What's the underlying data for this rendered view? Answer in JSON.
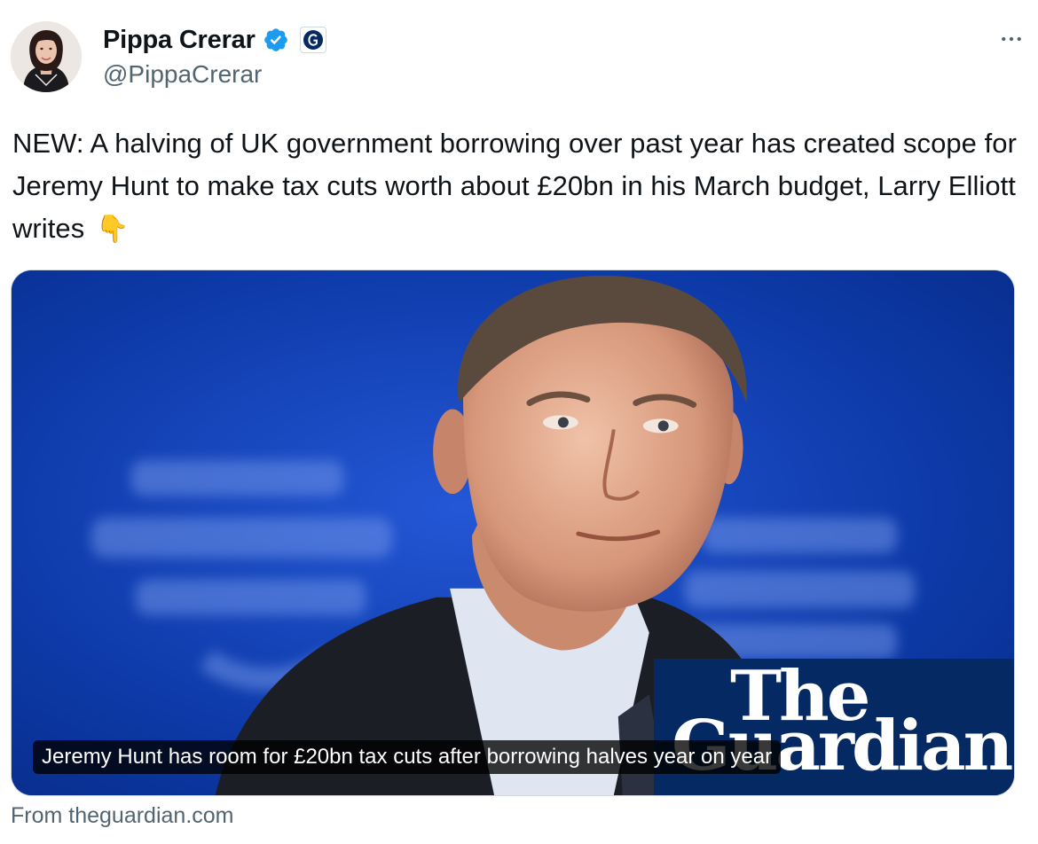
{
  "author": {
    "display_name": "Pippa Crerar",
    "handle": "@PippaCrerar",
    "verified_icon": "verified-badge-icon",
    "affiliate_icon": "guardian-g-icon",
    "avatar_icon": "avatar"
  },
  "more_icon": "more-dots-icon",
  "tweet": {
    "text": "NEW: A halving of UK government borrowing over past year has created scope for Jeremy Hunt to make tax cuts worth about £20bn in his March budget, Larry Elliott writes",
    "emoji": "👇"
  },
  "card": {
    "headline": "Jeremy Hunt has room for £20bn tax cuts after borrowing halves year on year",
    "logo_line1": "The",
    "logo_line2": "Guardian",
    "source": "From theguardian.com",
    "colors": {
      "background_blue": "#0c35a3",
      "logo_navy": "#052962"
    }
  },
  "colors": {
    "text_primary": "#0f1419",
    "text_secondary": "#536471",
    "verified_blue": "#1d9bf0",
    "border": "#cfd9de"
  }
}
